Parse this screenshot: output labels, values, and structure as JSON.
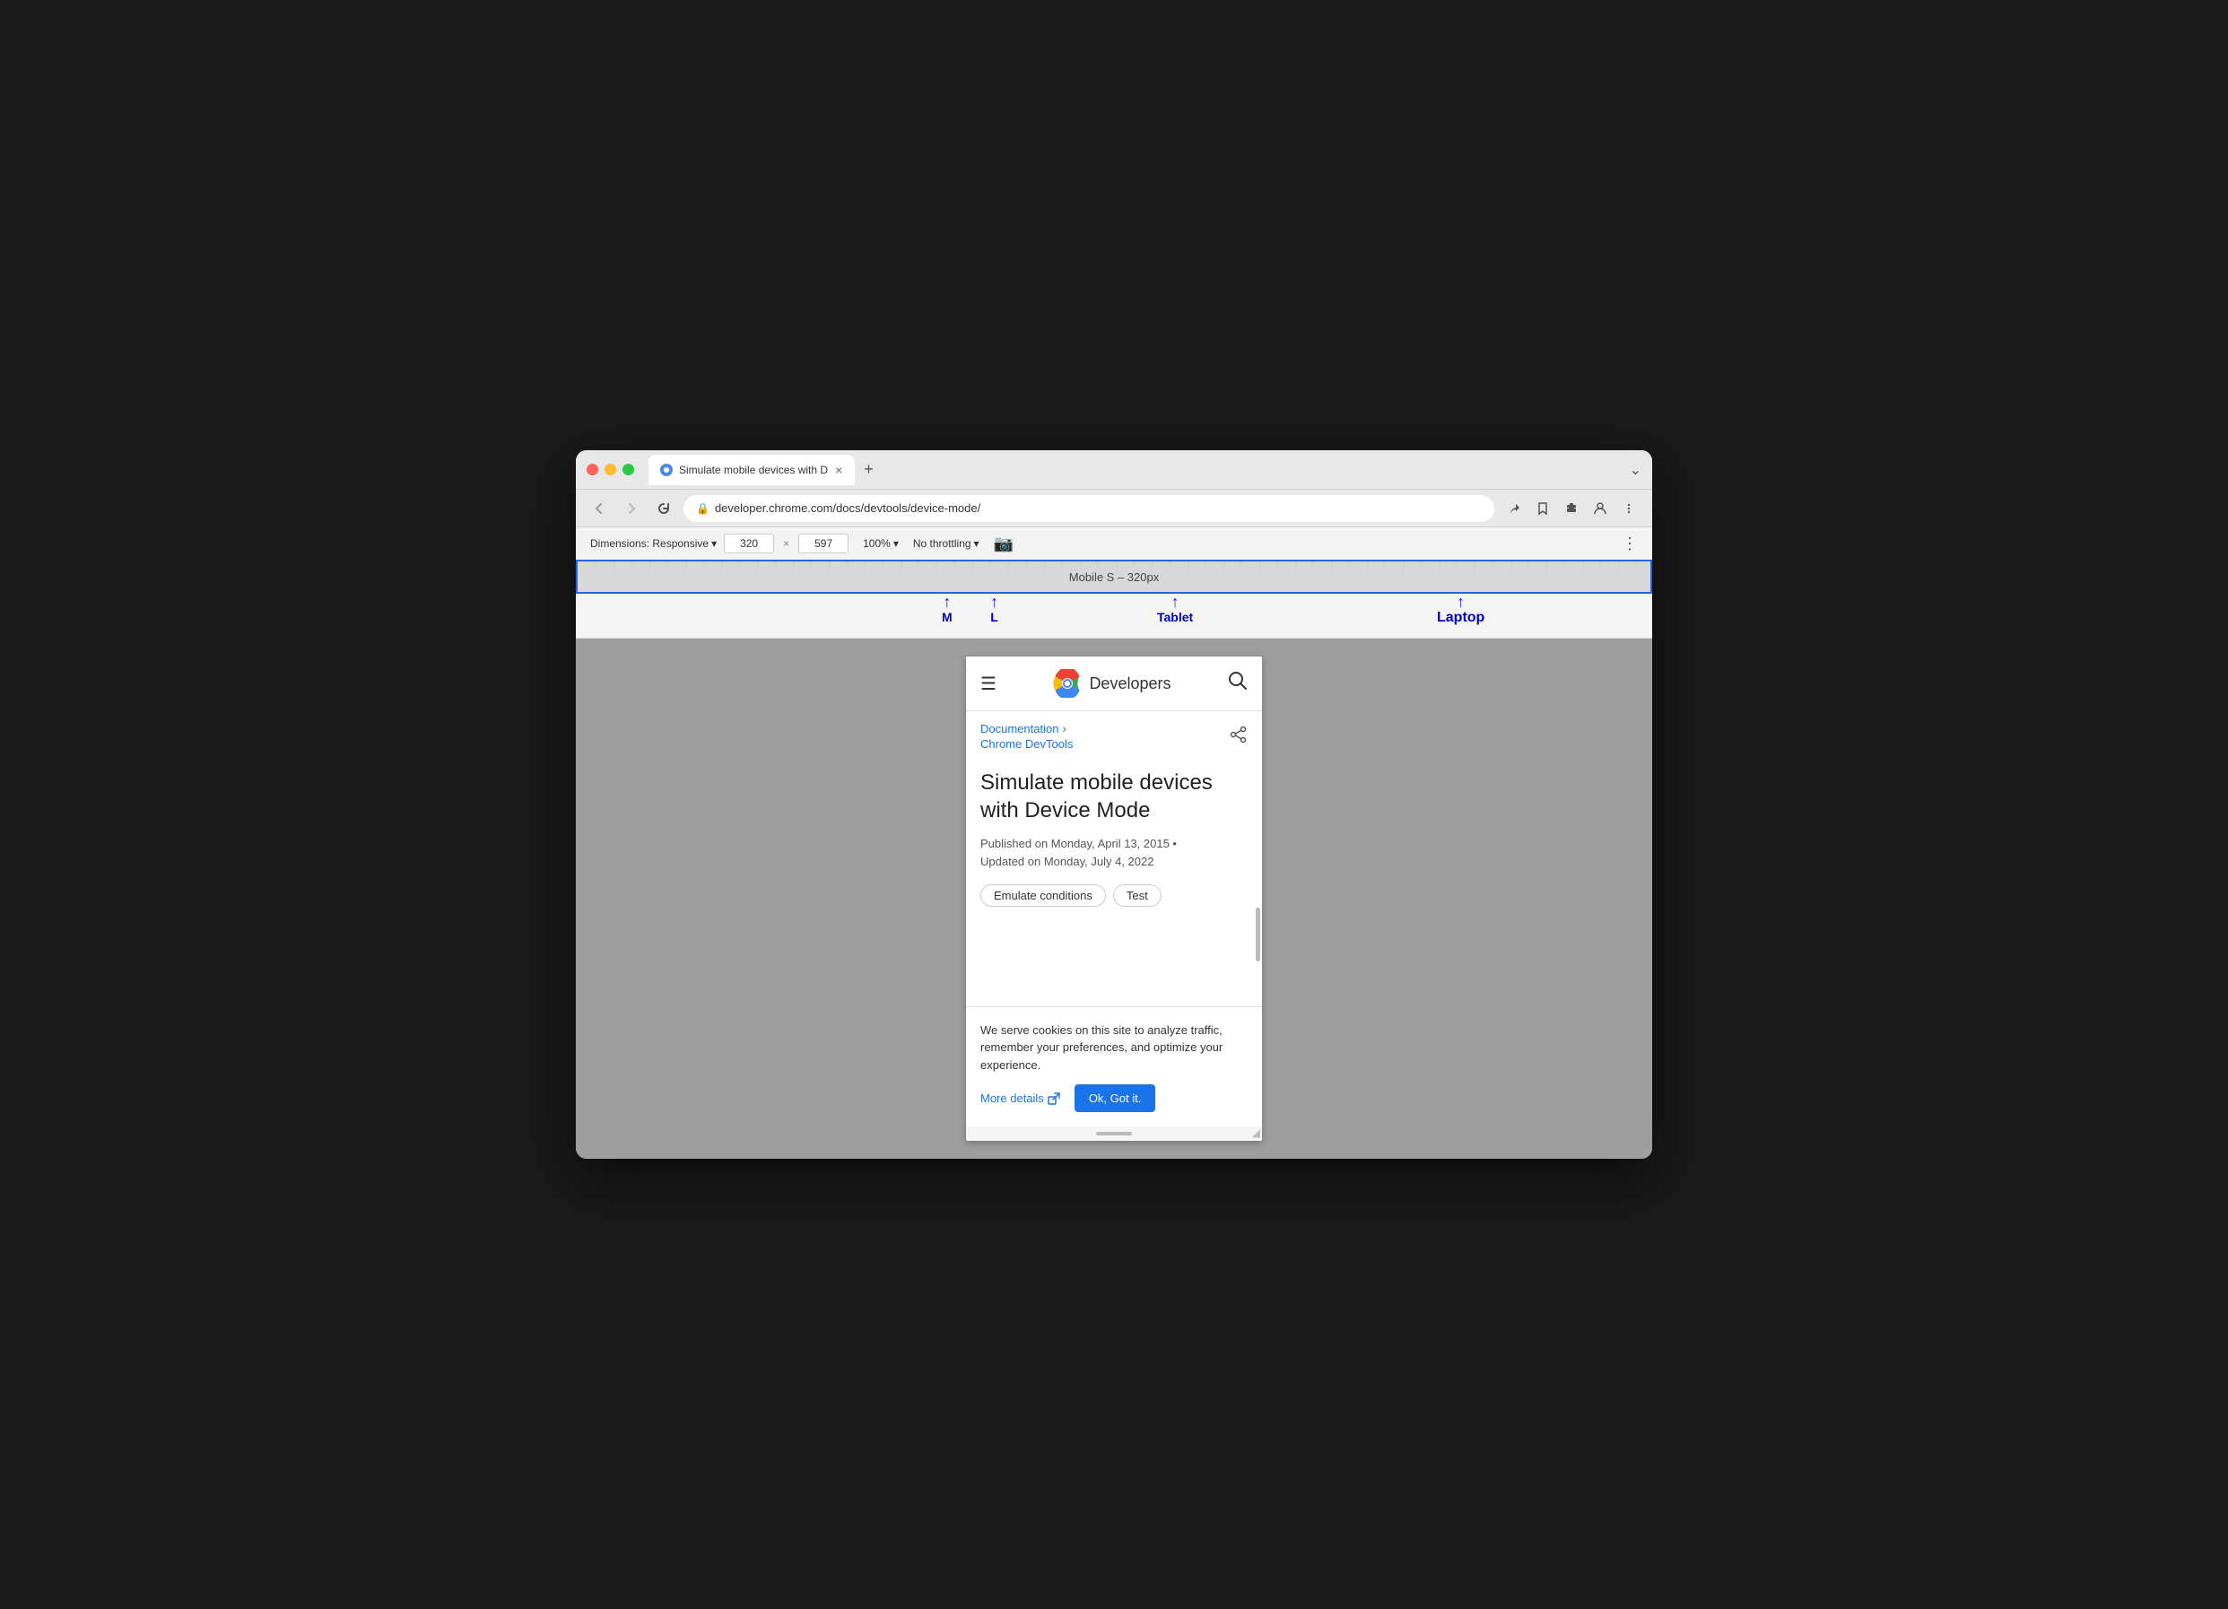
{
  "browser": {
    "tab_title": "Simulate mobile devices with D",
    "new_tab_btn": "+",
    "tab_menu_btn": "›",
    "url": "developer.chrome.com/docs/devtools/device-mode/",
    "back_btn": "←",
    "forward_btn": "→",
    "refresh_btn": "↻"
  },
  "devtools_toolbar": {
    "dimensions_label": "Dimensions: Responsive",
    "dimensions_arrow": "▾",
    "width_value": "320",
    "cross": "×",
    "height_value": "597",
    "zoom_value": "100%",
    "zoom_arrow": "▾",
    "throttle_label": "No throttling",
    "throttle_arrow": "▾",
    "more_btn": "⋮"
  },
  "responsive_bar": {
    "label": "Mobile S – 320px"
  },
  "breakpoints": [
    {
      "id": "m",
      "label": "M",
      "left_pct": 34
    },
    {
      "id": "l",
      "label": "L",
      "left_pct": 38
    },
    {
      "id": "tablet",
      "label": "Tablet",
      "left_pct": 55
    },
    {
      "id": "laptop",
      "label": "Laptop",
      "left_pct": 80
    }
  ],
  "mobile_page": {
    "header": {
      "hamburger": "☰",
      "logo_text": "Developers",
      "search_icon": "🔍"
    },
    "breadcrumb": {
      "documentation_link": "Documentation",
      "chevron": "›",
      "devtools_link": "Chrome DevTools"
    },
    "article": {
      "title": "Simulate mobile devices with Device Mode",
      "published": "Published on Monday, April 13, 2015 •",
      "updated": "Updated on Monday, July 4, 2022",
      "tag1": "Emulate conditions",
      "tag2": "Test"
    },
    "cookie_banner": {
      "text": "We serve cookies on this site to analyze traffic, remember your preferences, and optimize your experience.",
      "more_details": "More details",
      "external_icon": "↗",
      "ok_button": "Ok, Got it."
    }
  }
}
